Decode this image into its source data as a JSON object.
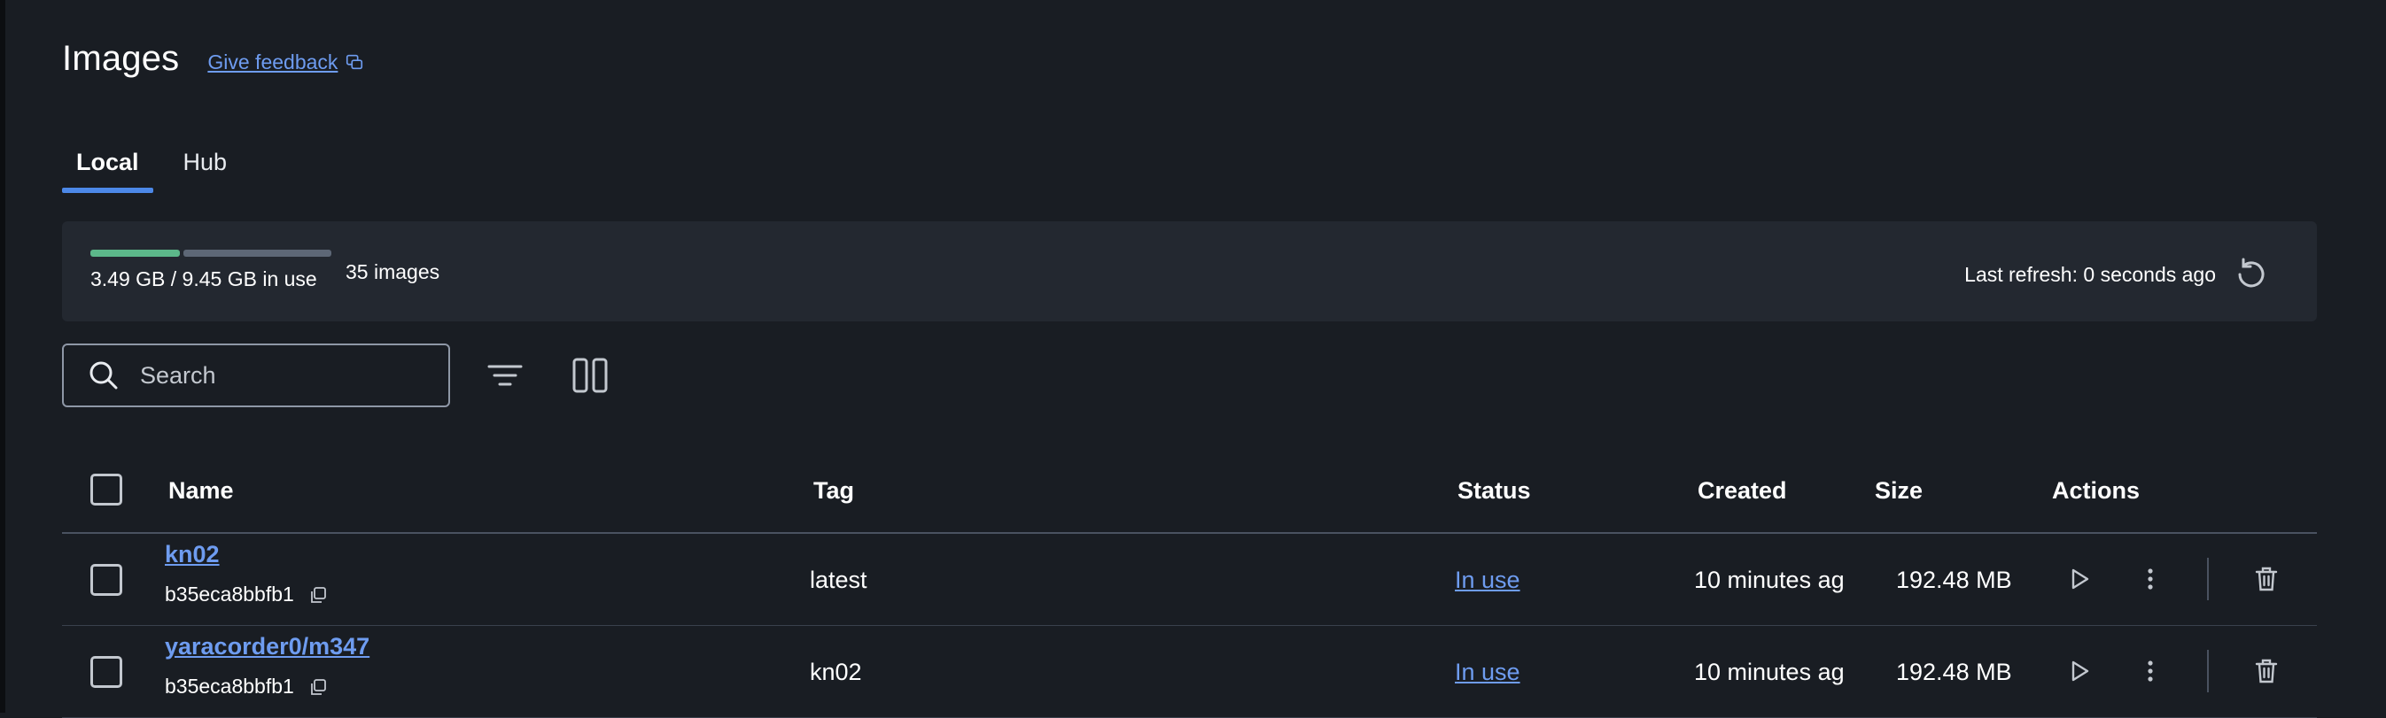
{
  "header": {
    "title": "Images",
    "feedback_label": "Give feedback"
  },
  "tabs": [
    {
      "label": "Local",
      "active": true
    },
    {
      "label": "Hub",
      "active": false
    }
  ],
  "usage": {
    "used_fraction": 0.37,
    "text": "3.49 GB / 9.45 GB in use",
    "count": "35 images",
    "last_refresh": "Last refresh: 0 seconds ago"
  },
  "search": {
    "placeholder": "Search",
    "value": ""
  },
  "table": {
    "columns": {
      "name": "Name",
      "tag": "Tag",
      "status": "Status",
      "created": "Created",
      "size": "Size",
      "actions": "Actions"
    },
    "rows": [
      {
        "name": "kn02",
        "id": "b35eca8bbfb1",
        "tag": "latest",
        "status": "In use",
        "created": "10 minutes ag",
        "size": "192.48 MB"
      },
      {
        "name": "yaracorder0/m347",
        "id": "b35eca8bbfb1",
        "tag": "kn02",
        "status": "In use",
        "created": "10 minutes ag",
        "size": "192.48 MB"
      }
    ]
  },
  "colors": {
    "background": "#191d23",
    "accent": "#4c88e8",
    "link": "#6e9cf0",
    "used_bar": "#5cb88a"
  },
  "icons": [
    "feedback-icon",
    "refresh-icon",
    "search-icon",
    "filter-icon",
    "columns-icon",
    "copy-icon",
    "play-icon",
    "more-vertical-icon",
    "trash-icon"
  ]
}
